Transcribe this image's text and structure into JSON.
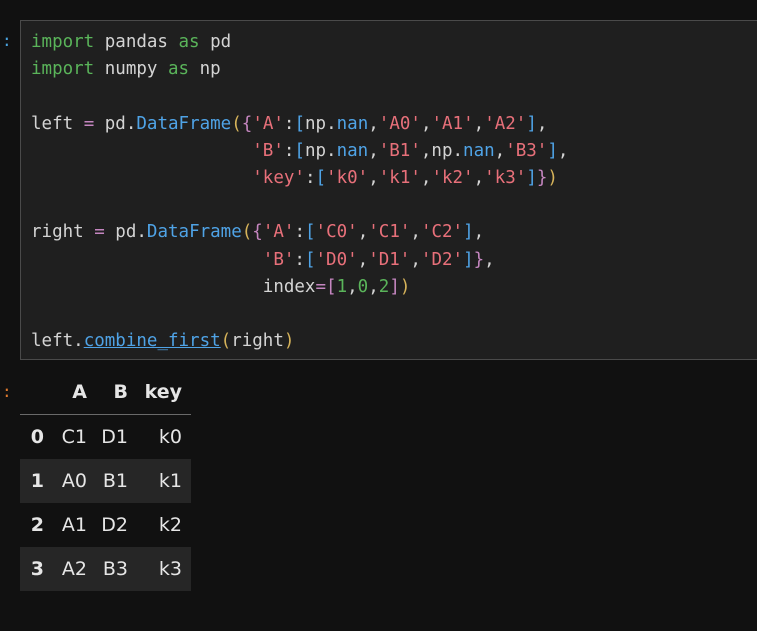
{
  "prompts": {
    "input": ":",
    "output": ":"
  },
  "code_lines": [
    "import pandas as pd",
    "import numpy as np",
    "",
    "left = pd.DataFrame({'A':[np.nan,'A0','A1','A2'],",
    "                     'B':[np.nan,'B1',np.nan,'B3'],",
    "                     'key':['k0','k1','k2','k3']})",
    "",
    "right = pd.DataFrame({'A':['C0','C1','C2'],",
    "                      'B':['D0','D1','D2']},",
    "                      index=[1,0,2])",
    "",
    "left.combine_first(right)"
  ],
  "dataframe": {
    "columns": [
      "A",
      "B",
      "key"
    ],
    "rows": [
      {
        "index": "0",
        "A": "C1",
        "B": "D1",
        "key": "k0"
      },
      {
        "index": "1",
        "A": "A0",
        "B": "B1",
        "key": "k1"
      },
      {
        "index": "2",
        "A": "A1",
        "B": "D2",
        "key": "k2"
      },
      {
        "index": "3",
        "A": "A2",
        "B": "B3",
        "key": "k3"
      }
    ]
  },
  "colors": {
    "background": "#111111",
    "cell_background": "#1f1f1f",
    "keyword": "#5ab45a",
    "function": "#4fa3e6",
    "string": "#e8707a",
    "input_prompt": "#4aa3df",
    "output_prompt": "#e07a2e"
  }
}
